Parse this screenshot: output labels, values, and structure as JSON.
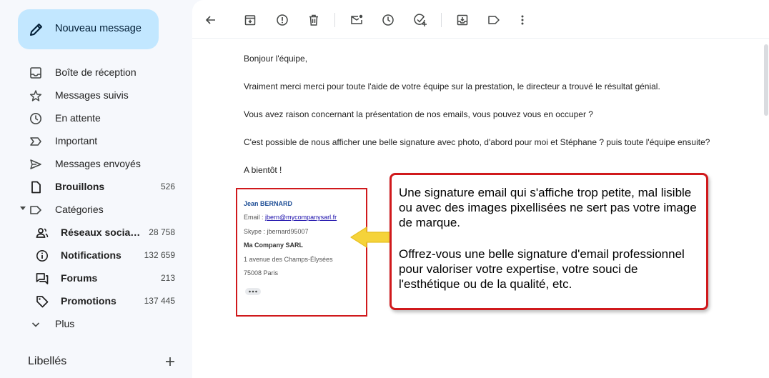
{
  "compose": {
    "label": "Nouveau message"
  },
  "nav": [
    {
      "label": "Boîte de réception",
      "icon": "inbox-icon",
      "count": ""
    },
    {
      "label": "Messages suivis",
      "icon": "star-icon",
      "count": ""
    },
    {
      "label": "En attente",
      "icon": "clock-icon",
      "count": ""
    },
    {
      "label": "Important",
      "icon": "important-icon",
      "count": ""
    },
    {
      "label": "Messages envoyés",
      "icon": "send-icon",
      "count": ""
    },
    {
      "label": "Brouillons",
      "icon": "draft-icon",
      "count": "526"
    },
    {
      "label": "Catégories",
      "icon": "label-icon",
      "count": ""
    }
  ],
  "categories": [
    {
      "label": "Réseaux sociaux",
      "icon": "people-icon",
      "count": "28 758"
    },
    {
      "label": "Notifications",
      "icon": "info-icon",
      "count": "132 659"
    },
    {
      "label": "Forums",
      "icon": "forum-icon",
      "count": "213"
    },
    {
      "label": "Promotions",
      "icon": "tag-icon",
      "count": "137 445"
    }
  ],
  "more": {
    "label": "Plus"
  },
  "labels": {
    "title": "Libellés"
  },
  "toolbar": [
    "back-icon",
    "archive-icon",
    "report-spam-icon",
    "delete-icon",
    "mark-unread-icon",
    "snooze-icon",
    "add-task-icon",
    "move-to-icon",
    "label-icon",
    "more-vert-icon"
  ],
  "email": {
    "lines": [
      "Bonjour l'équipe,",
      "Vraiment merci merci pour toute l'aide de votre équipe sur la prestation, le directeur a trouvé le résultat génial.",
      "Vous avez raison concernant la présentation de nos emails, vous pouvez vous en occuper ?",
      "C'est possible de nous afficher une belle signature avec photo, d'abord pour moi et Stéphane ? puis toute l'équipe ensuite?",
      "A bientôt !"
    ],
    "signature": {
      "name": "Jean BERNARD",
      "email_label": "Email : ",
      "email": "jbern@mycompanysarl.fr",
      "skype": "Skype : jbernard95007",
      "company": "Ma Company SARL",
      "address1": "1 avenue des Champs-Élysées",
      "address2": "75008 Paris"
    }
  },
  "callout": {
    "paragraph1": "Une signature email qui s'affiche trop petite, mal lisible ou avec des images pixellisées ne sert pas votre image de marque.",
    "paragraph2": "Offrez-vous une belle signature d'email professionnel pour valoriser votre expertise, votre souci de l'esthétique ou de la qualité, etc."
  },
  "colors": {
    "compose_bg": "#c2e7ff",
    "highlight_red": "#d0191c",
    "arrow_yellow": "#f5d33a",
    "sidebar_bg": "#f6f8fc"
  }
}
